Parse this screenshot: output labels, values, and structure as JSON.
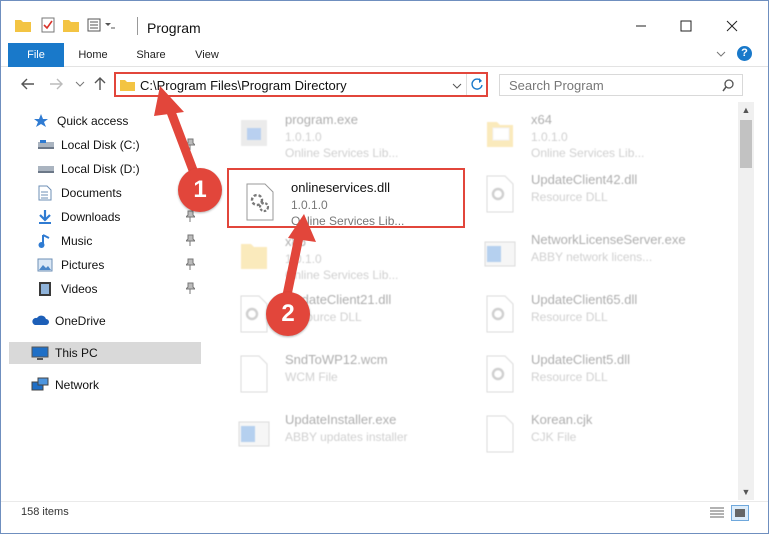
{
  "window": {
    "title": "Program"
  },
  "ribbon": {
    "tabs": [
      "File",
      "Home",
      "Share",
      "View"
    ]
  },
  "address": {
    "path": "C:\\Program Files\\Program Directory"
  },
  "search": {
    "placeholder": "Search Program"
  },
  "nav": {
    "items": [
      {
        "label": "Quick access",
        "icon": "star-icon"
      },
      {
        "label": "Local Disk (C:)",
        "icon": "drive-icon",
        "pinned": true
      },
      {
        "label": "Local Disk (D:)",
        "icon": "drive-icon"
      },
      {
        "label": "Documents",
        "icon": "documents-icon",
        "pinned": true
      },
      {
        "label": "Downloads",
        "icon": "downloads-icon",
        "pinned": true
      },
      {
        "label": "Music",
        "icon": "music-icon",
        "pinned": true
      },
      {
        "label": "Pictures",
        "icon": "pictures-icon",
        "pinned": true
      },
      {
        "label": "Videos",
        "icon": "videos-icon",
        "pinned": true
      },
      {
        "label": "OneDrive",
        "icon": "cloud-icon"
      },
      {
        "label": "This PC",
        "icon": "computer-icon",
        "selected": true
      },
      {
        "label": "Network",
        "icon": "network-icon"
      }
    ]
  },
  "files": [
    {
      "name": "program.exe",
      "line1": "1.0.1.0",
      "line2": "Online Services Lib...",
      "icon": "exe-icon"
    },
    {
      "name": "x64",
      "line1": "1.0.1.0",
      "line2": "Online Services Lib...",
      "icon": "folder-icon"
    },
    {
      "name": "onlineservices.dll",
      "line1": "1.0.1.0",
      "line2": "Online Services Lib...",
      "icon": "dll-icon",
      "highlighted": true
    },
    {
      "name": "UpdateClient42.dll",
      "line1": "Resource DLL",
      "line2": "",
      "icon": "dll-icon"
    },
    {
      "name": "x86",
      "line1": "1.0.1.0",
      "line2": "Online Services Lib...",
      "icon": "folder-icon"
    },
    {
      "name": "NetworkLicenseServer.exe",
      "line1": "ABBY network licens...",
      "line2": "",
      "icon": "exe-icon"
    },
    {
      "name": "UpdateClient21.dll",
      "line1": "Resource DLL",
      "line2": "",
      "icon": "dll-icon"
    },
    {
      "name": "UpdateClient65.dll",
      "line1": "Resource DLL",
      "line2": "",
      "icon": "dll-icon"
    },
    {
      "name": "SndToWP12.wcm",
      "line1": "WCM File",
      "line2": "",
      "icon": "file-icon"
    },
    {
      "name": "UpdateClient5.dll",
      "line1": "Resource DLL",
      "line2": "",
      "icon": "dll-icon"
    },
    {
      "name": "UpdateInstaller.exe",
      "line1": "ABBY updates installer",
      "line2": "",
      "icon": "exe-icon"
    },
    {
      "name": "Korean.cjk",
      "line1": "CJK File",
      "line2": "",
      "icon": "file-icon"
    }
  ],
  "status": {
    "count": "158 items"
  },
  "callouts": [
    "1",
    "2"
  ],
  "colors": {
    "accent": "#1979ca",
    "annotation": "#e2463b"
  }
}
